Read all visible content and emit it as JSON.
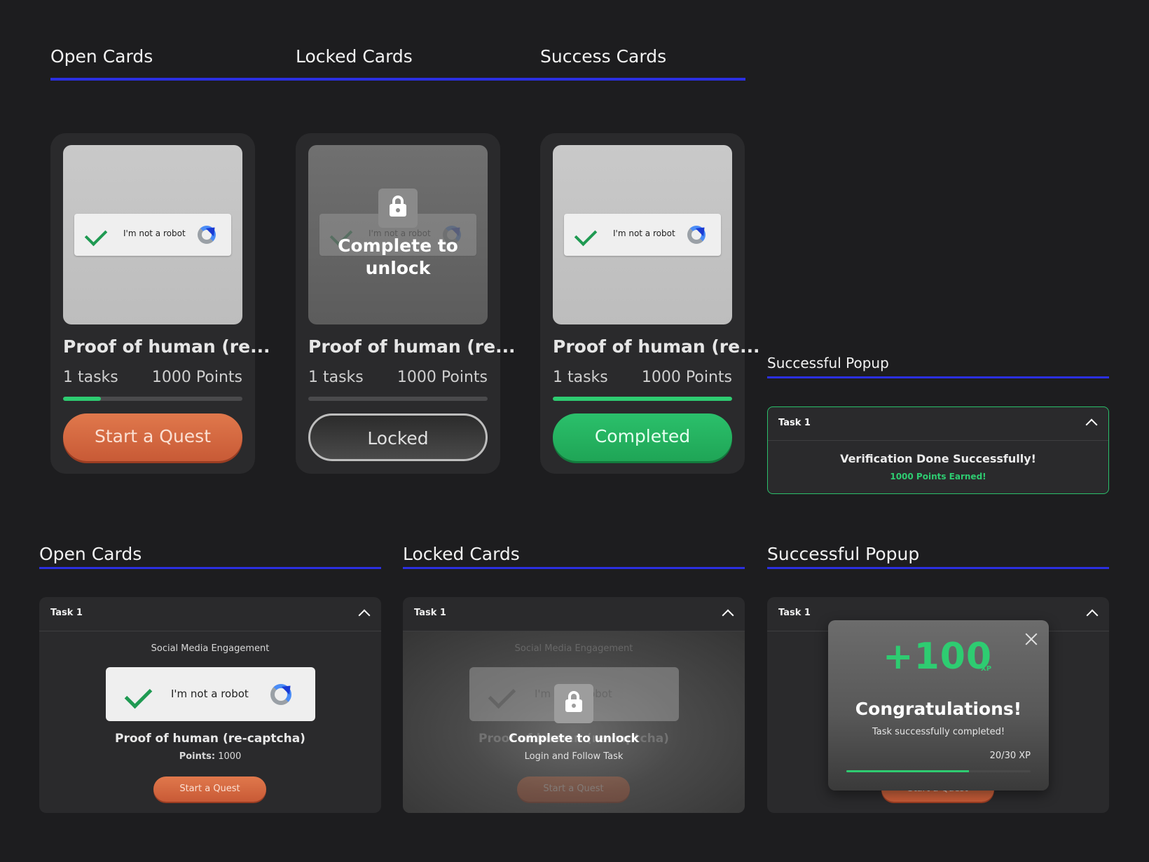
{
  "top_tabs": [
    "Open Cards",
    "Locked Cards",
    "Success Cards"
  ],
  "quest_cards": [
    {
      "title": "Proof of human (re...",
      "tasks": "1 tasks",
      "points": "1000 Points",
      "button": "Start a Quest",
      "captcha_text": "I'm not a robot",
      "progress": 0.21,
      "state": "open"
    },
    {
      "title": "Proof of human (re...",
      "tasks": "1 tasks",
      "points": "1000 Points",
      "button": "Locked",
      "captcha_text": "I'm not a robot",
      "overlay": "Complete to unlock",
      "progress": 0,
      "state": "locked"
    },
    {
      "title": "Proof of human (re...",
      "tasks": "1 tasks",
      "points": "1000 Points",
      "button": "Completed",
      "captcha_text": "I'm not a robot",
      "progress": 1.0,
      "state": "success"
    }
  ],
  "successful_popup_small": {
    "section_title": "Successful Popup",
    "task_name": "Task 1",
    "message": "Verification Done Successfully!",
    "points_earned": "1000 Points Earned!"
  },
  "bottom_sections": [
    "Open Cards",
    "Locked Cards",
    "Successful Popup"
  ],
  "task_panel_open": {
    "task_name": "Task 1",
    "category": "Social Media Engagement",
    "captcha_text": "I'm not a robot",
    "title": "Proof of human (re-captcha)",
    "points_label": "Points:",
    "points_value": "1000",
    "button": "Start a Quest"
  },
  "task_panel_locked": {
    "task_name": "Task 1",
    "category": "Social Media Engagement",
    "captcha_text": "I'm not a robot",
    "title": "Proof of human (re-captcha)",
    "overlay_title": "Complete to unlock",
    "overlay_subtitle": "Login and Follow Task",
    "button": "Start a Quest"
  },
  "task_panel_success": {
    "task_name": "Task 1",
    "xp_amount": "+100",
    "xp_unit": "XP",
    "headline": "Congratulations!",
    "subtitle": "Task successfully completed!",
    "xp_progress": "20/30 XP",
    "xp_fraction": 0.6667,
    "button": "Start a Quest"
  },
  "colors": {
    "background": "#1d1d1f",
    "accent_blue": "#2b2fe0",
    "success_green": "#2ecc71",
    "orange": "#d96a42"
  }
}
